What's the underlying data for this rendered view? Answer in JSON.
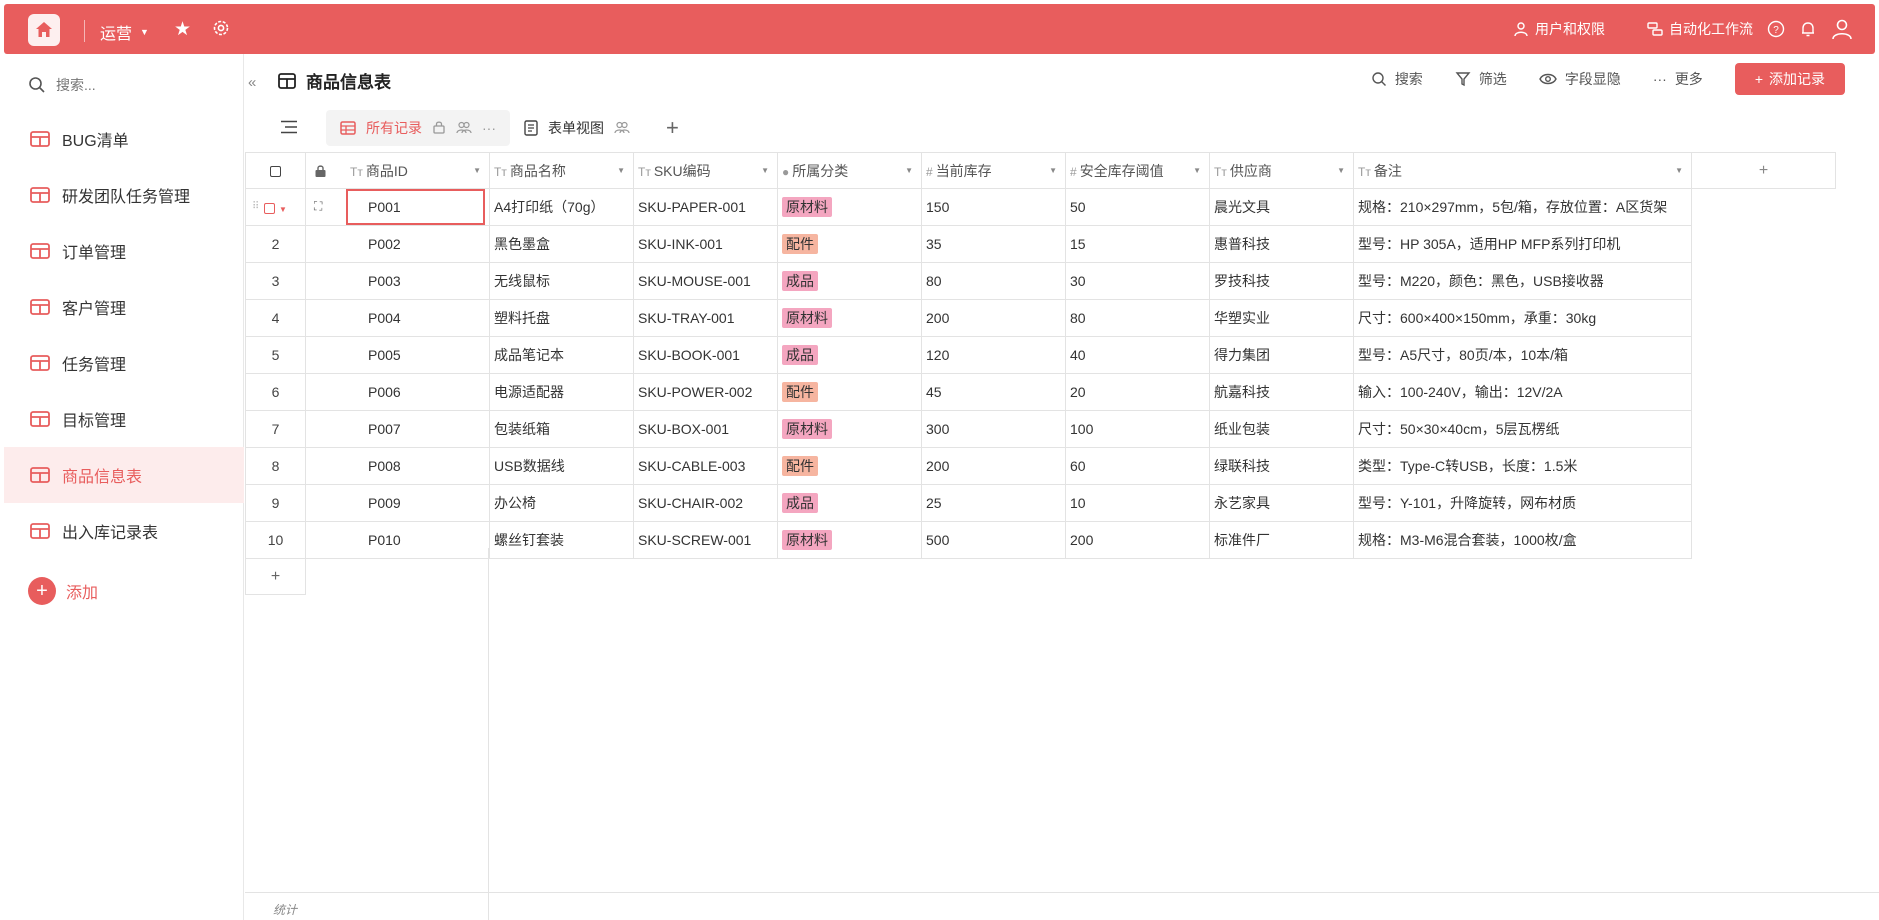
{
  "topbar": {
    "workspace": "运营",
    "users_label": "用户和权限",
    "automation_label": "自动化工作流",
    "accent": "#e85d5d"
  },
  "sidebar": {
    "search_placeholder": "搜索...",
    "items": [
      {
        "label": "BUG清单"
      },
      {
        "label": "研发团队任务管理"
      },
      {
        "label": "订单管理"
      },
      {
        "label": "客户管理"
      },
      {
        "label": "任务管理"
      },
      {
        "label": "目标管理"
      },
      {
        "label": "商品信息表",
        "active": true
      },
      {
        "label": "出入库记录表"
      }
    ],
    "add_label": "添加"
  },
  "header": {
    "title": "商品信息表",
    "search_label": "搜索",
    "filter_label": "筛选",
    "fields_label": "字段显隐",
    "more_label": "更多",
    "add_record_label": "添加记录"
  },
  "tabs": [
    {
      "label": "所有记录",
      "active": true
    },
    {
      "label": "表单视图"
    }
  ],
  "table": {
    "columns": [
      "商品ID",
      "商品名称",
      "SKU编码",
      "所属分类",
      "当前库存",
      "安全库存阈值",
      "供应商",
      "备注"
    ],
    "rows": [
      {
        "n": "",
        "id": "P001",
        "name": "A4打印纸（70g）",
        "sku": "SKU-PAPER-001",
        "cat": "原材料",
        "stock": "150",
        "safe": "50",
        "supplier": "晨光文具",
        "note": "规格：210×297mm，5包/箱，存放位置：A区货架"
      },
      {
        "n": "2",
        "id": "P002",
        "name": "黑色墨盒",
        "sku": "SKU-INK-001",
        "cat": "配件",
        "stock": "35",
        "safe": "15",
        "supplier": "惠普科技",
        "note": "型号：HP 305A，适用HP MFP系列打印机"
      },
      {
        "n": "3",
        "id": "P003",
        "name": "无线鼠标",
        "sku": "SKU-MOUSE-001",
        "cat": "成品",
        "stock": "80",
        "safe": "30",
        "supplier": "罗技科技",
        "note": "型号：M220，颜色：黑色，USB接收器"
      },
      {
        "n": "4",
        "id": "P004",
        "name": "塑料托盘",
        "sku": "SKU-TRAY-001",
        "cat": "原材料",
        "stock": "200",
        "safe": "80",
        "supplier": "华塑实业",
        "note": "尺寸：600×400×150mm，承重：30kg"
      },
      {
        "n": "5",
        "id": "P005",
        "name": "成品笔记本",
        "sku": "SKU-BOOK-001",
        "cat": "成品",
        "stock": "120",
        "safe": "40",
        "supplier": "得力集团",
        "note": "型号：A5尺寸，80页/本，10本/箱"
      },
      {
        "n": "6",
        "id": "P006",
        "name": "电源适配器",
        "sku": "SKU-POWER-002",
        "cat": "配件",
        "stock": "45",
        "safe": "20",
        "supplier": "航嘉科技",
        "note": "输入：100-240V，输出：12V/2A"
      },
      {
        "n": "7",
        "id": "P007",
        "name": "包装纸箱",
        "sku": "SKU-BOX-001",
        "cat": "原材料",
        "stock": "300",
        "safe": "100",
        "supplier": "纸业包装",
        "note": "尺寸：50×30×40cm，5层瓦楞纸"
      },
      {
        "n": "8",
        "id": "P008",
        "name": "USB数据线",
        "sku": "SKU-CABLE-003",
        "cat": "配件",
        "stock": "200",
        "safe": "60",
        "supplier": "绿联科技",
        "note": "类型：Type-C转USB，长度：1.5米"
      },
      {
        "n": "9",
        "id": "P009",
        "name": "办公椅",
        "sku": "SKU-CHAIR-002",
        "cat": "成品",
        "stock": "25",
        "safe": "10",
        "supplier": "永艺家具",
        "note": "型号：Y-101，升降旋转，网布材质"
      },
      {
        "n": "10",
        "id": "P010",
        "name": "螺丝钉套装",
        "sku": "SKU-SCREW-001",
        "cat": "原材料",
        "stock": "500",
        "safe": "200",
        "supplier": "标准件厂",
        "note": "规格：M3-M6混合套装，1000枚/盒"
      }
    ]
  },
  "footer": {
    "stats_label": "统计"
  }
}
